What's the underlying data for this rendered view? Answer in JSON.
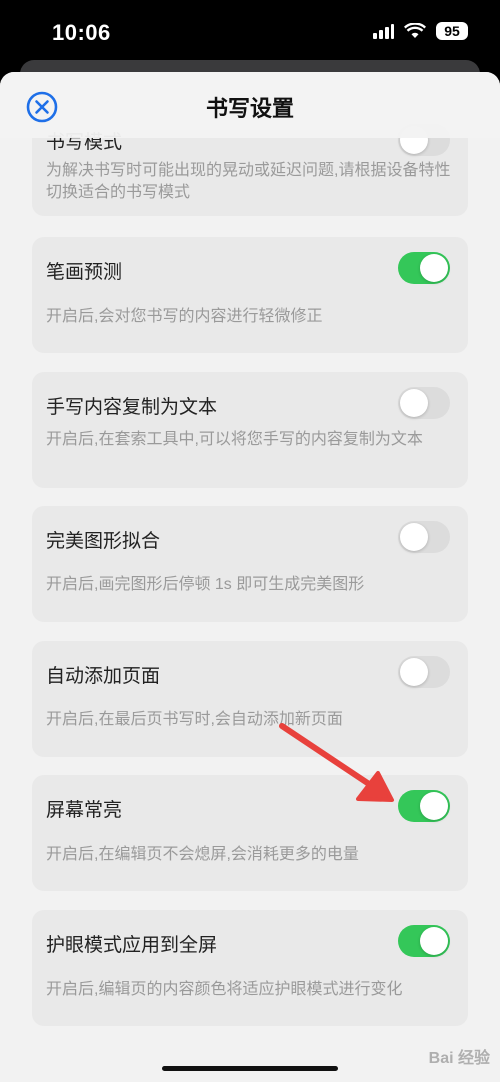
{
  "status": {
    "time": "10:06",
    "battery": "95"
  },
  "nav": {
    "title": "书写设置"
  },
  "settings": [
    {
      "title": "书写模式",
      "desc": "为解决书写时可能出现的晃动或延迟问题,请根据设备特性切换适合的书写模式",
      "on": false
    },
    {
      "title": "笔画预测",
      "desc": "开启后,会对您书写的内容进行轻微修正",
      "on": true
    },
    {
      "title": "手写内容复制为文本",
      "desc": "开启后,在套索工具中,可以将您手写的内容复制为文本",
      "on": false
    },
    {
      "title": "完美图形拟合",
      "desc": "开启后,画完图形后停顿 1s 即可生成完美图形",
      "on": false
    },
    {
      "title": "自动添加页面",
      "desc": "开启后,在最后页书写时,会自动添加新页面",
      "on": false
    },
    {
      "title": "屏幕常亮",
      "desc": "开启后,在编辑页不会熄屏,会消耗更多的电量",
      "on": true
    },
    {
      "title": "护眼模式应用到全屏",
      "desc": "开启后,编辑页的内容颜色将适应护眼模式进行变化",
      "on": true
    }
  ],
  "watermark": "Bai 经验",
  "colors": {
    "accent": "#1e6fe8",
    "toggle_on": "#34c759",
    "annotation_arrow": "#e8413c"
  }
}
